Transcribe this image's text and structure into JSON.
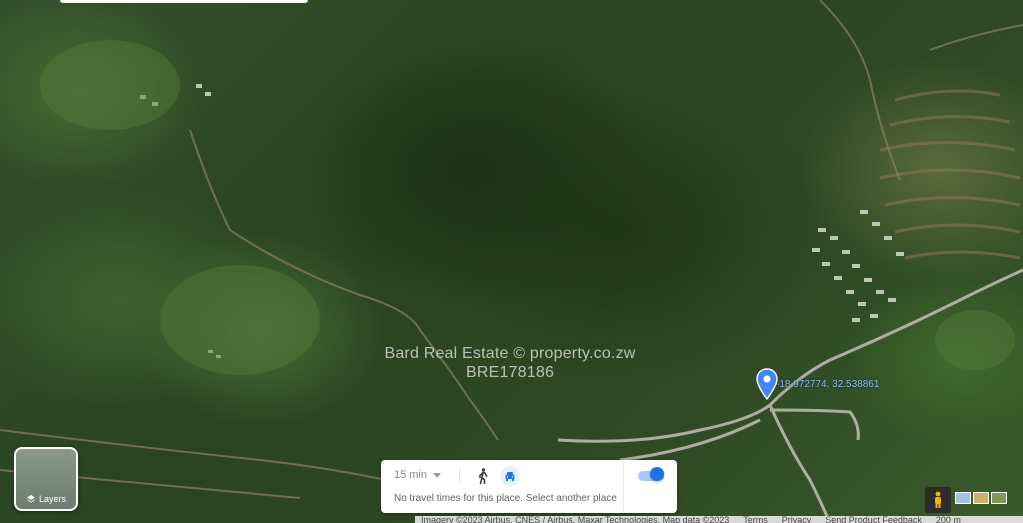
{
  "map": {
    "watermark_line1": "Bard Real Estate  ©  property.co.zw",
    "watermark_line2": "BRE178186",
    "pin_coords": "-18.972774, 32.538861"
  },
  "layers_button": {
    "label": "Layers",
    "icon": "layers-icon"
  },
  "travel_card": {
    "time_value": "15 min",
    "walk_icon": "walking-person-icon",
    "car_icon": "car-icon",
    "message": "No travel times for this place. Select another place",
    "toggle_on": true
  },
  "attribution": {
    "imagery": "Imagery ©2023 Airbus, CNES / Airbus, Maxar Technologies, Map data ©2023",
    "terms": "Terms",
    "privacy": "Privacy",
    "feedback": "Send Product Feedback",
    "scale": "200 m"
  },
  "colors": {
    "pin_blue": "#4285f4",
    "accent_blue": "#1a73e8",
    "vegetation_dark": "#1f3318",
    "vegetation_light": "#4e7238"
  }
}
